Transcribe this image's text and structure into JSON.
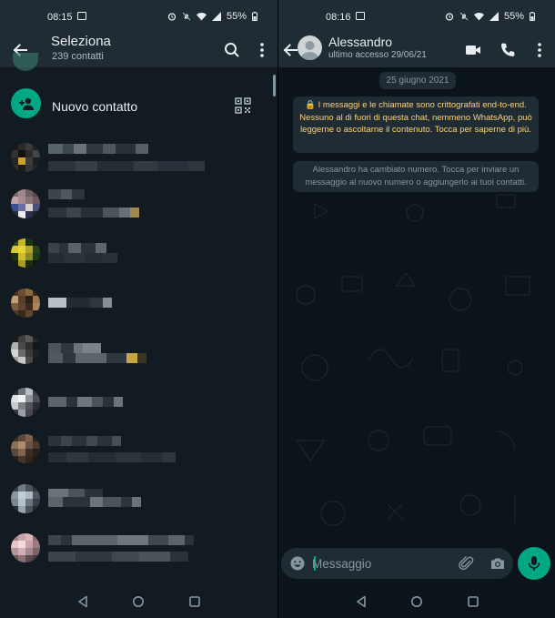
{
  "left": {
    "status": {
      "time": "08:15",
      "battery": "55%"
    },
    "header": {
      "title": "Seleziona",
      "subtitle": "239 contatti"
    },
    "new_contact_label": "Nuovo contatto"
  },
  "right": {
    "status": {
      "time": "08:16",
      "battery": "55%"
    },
    "header": {
      "contact_name": "Alessandro",
      "last_seen": "ultimo accesso 29/06/21"
    },
    "date_chip": "25 giugno 2021",
    "encryption_notice": "🔒 I messaggi e le chiamate sono crittografati end-to-end. Nessuno al di fuori di questa chat, nemmeno WhatsApp, può leggerne o ascoltarne il contenuto. Tocca per saperne di più.",
    "number_change_notice": "Alessandro ha cambiato numero. Tocca per inviare un messaggio al nuovo numero o aggiungerlo ai tuoi contatti.",
    "input_placeholder": "Messaggio"
  },
  "colors": {
    "accent": "#00a884",
    "header_bg": "#1f2c34",
    "list_bg": "#111b21",
    "chat_bg": "#0b141a",
    "notice_yellow": "#ffd279"
  }
}
